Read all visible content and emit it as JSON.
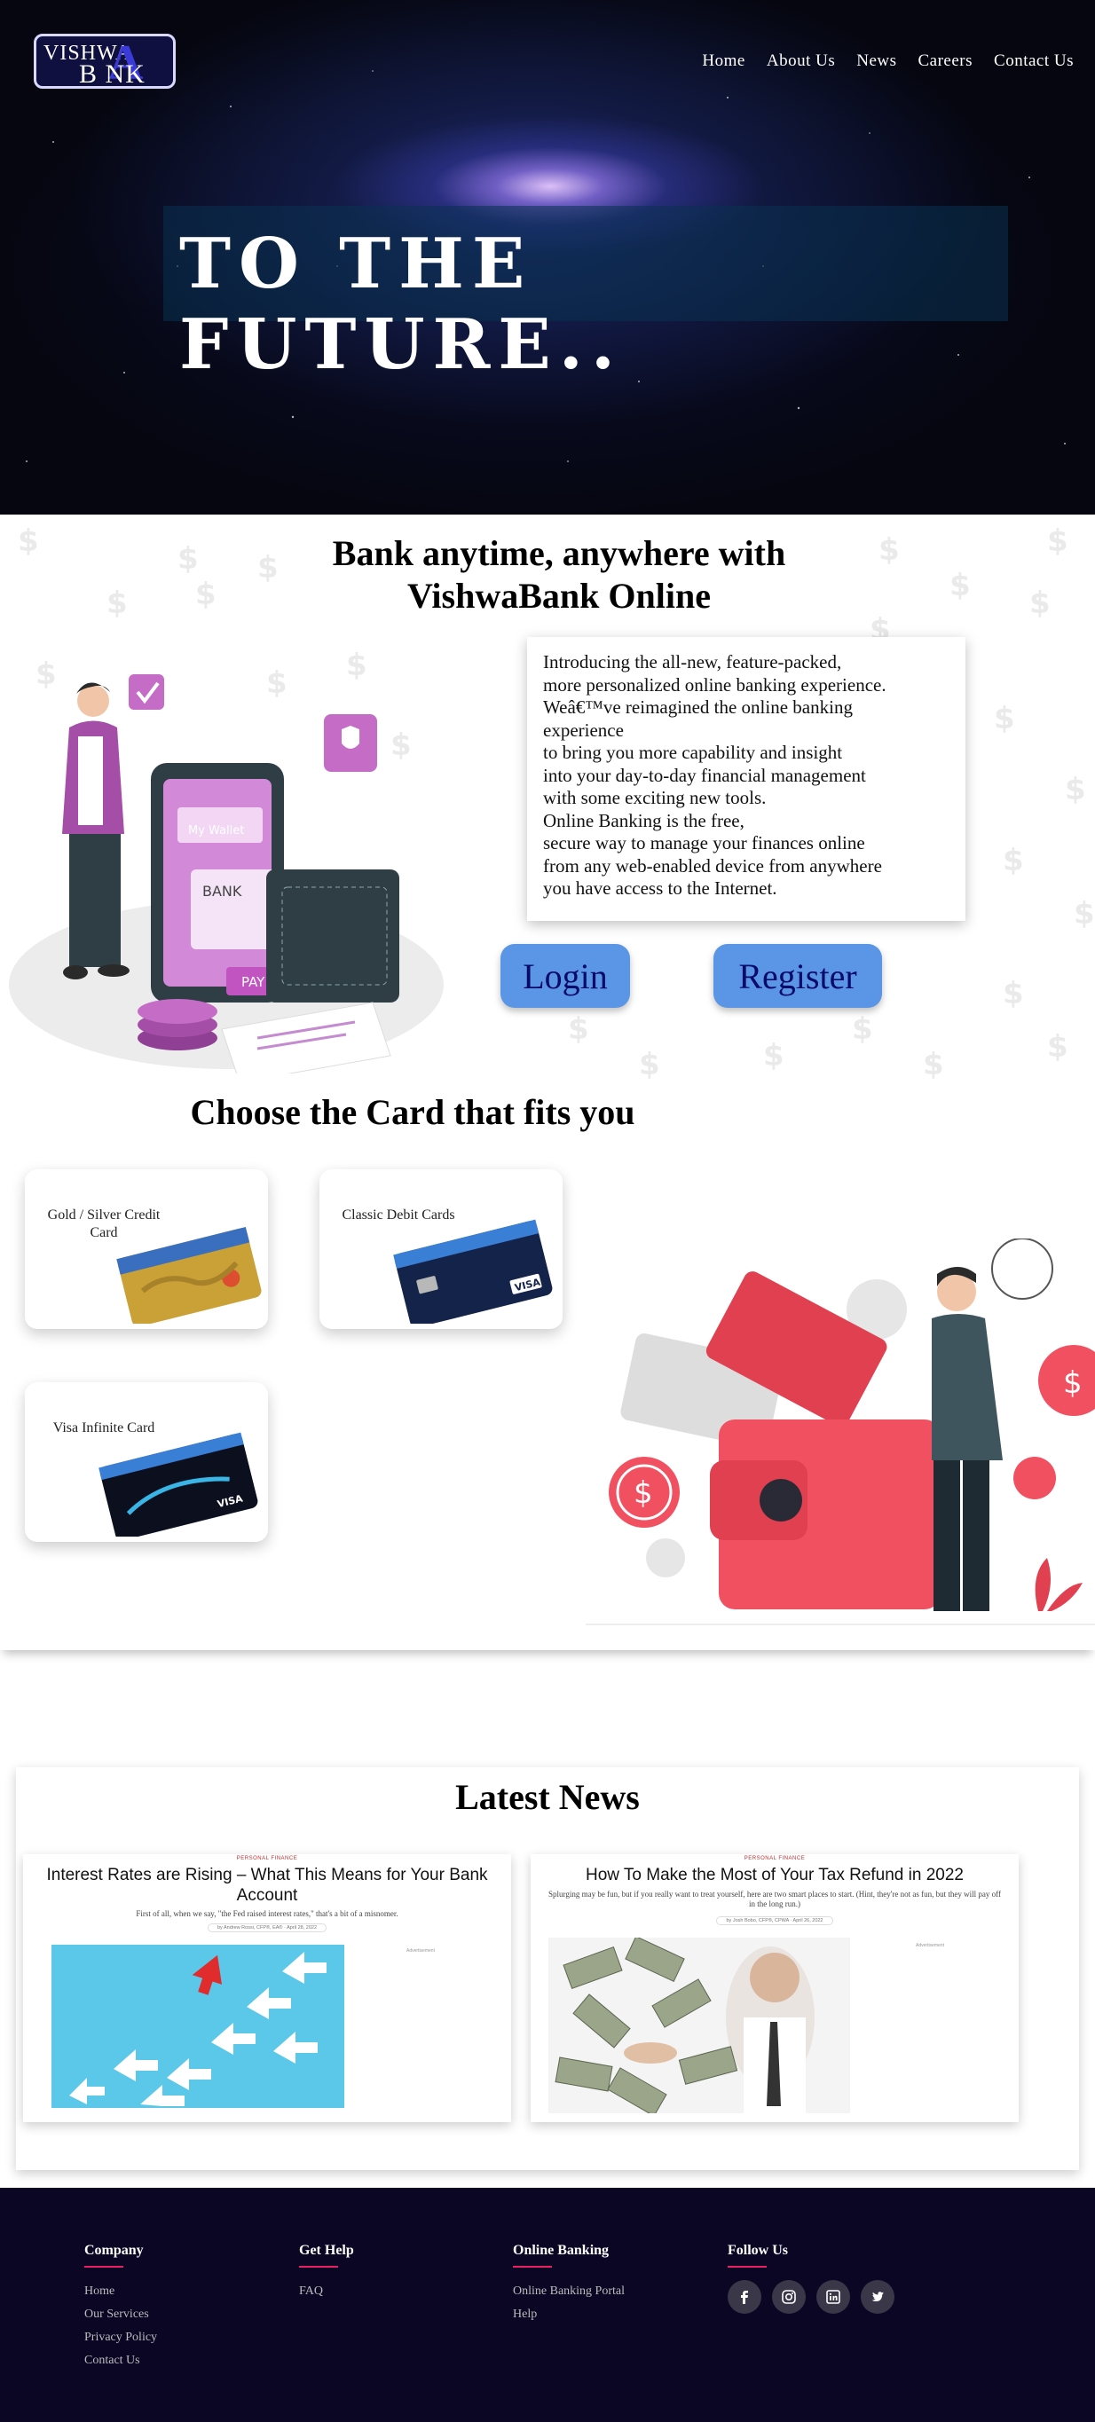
{
  "header": {
    "logo_top": "VISHWA",
    "logo_bottom": "B  NK",
    "logo_a": "A",
    "nav": [
      "Home",
      "About Us",
      "News",
      "Careers",
      "Contact Us"
    ],
    "hero_title": "TO THE FUTURE.."
  },
  "online": {
    "title_line1": "Bank anytime, anywhere with",
    "title_line2": "VishwaBank Online",
    "intro_lines": [
      "Introducing the all-new, feature-packed,",
      "more personalized online banking experience.",
      "Weâ€™ve reimagined the online banking",
      "experience",
      "to bring you more capability and insight",
      "into your day-to-day financial management",
      "with some exciting new tools.",
      "Online Banking is the free,",
      "secure way to manage your finances online",
      "from any web-enabled device from anywhere",
      "you have access to the Internet."
    ],
    "login_label": "Login",
    "register_label": "Register"
  },
  "cards": {
    "title": "Choose the Card that fits you",
    "items": [
      {
        "label": "Gold / Silver Credit Card"
      },
      {
        "label": "Classic Debit Cards"
      },
      {
        "label": "Visa Infinite Card"
      }
    ]
  },
  "news": {
    "title": "Latest News",
    "items": [
      {
        "category": "PERSONAL FINANCE",
        "headline": "Interest Rates are Rising – What This Means for Your Bank Account",
        "excerpt": "First of all, when we say, \"the Fed raised interest rates,\" that's a bit of a misnomer.",
        "meta": "by Andrew Rossi, CFP®, EA® · April 28, 2022",
        "ad_label": "Advertisement"
      },
      {
        "category": "PERSONAL FINANCE",
        "headline": "How To Make the Most of Your Tax Refund in 2022",
        "excerpt": "Splurging may be fun, but if you really want to treat yourself, here are two smart places to start. (Hint, they're not as fun, but they will pay off in the long run.)",
        "meta": "by Josh Bobo, CFP®, CPWA · April 26, 2022",
        "ad_label": "Advertisement"
      }
    ]
  },
  "footer": {
    "columns": [
      {
        "heading": "Company",
        "links": [
          "Home",
          "Our Services",
          "Privacy Policy",
          "Contact Us"
        ]
      },
      {
        "heading": "Get Help",
        "links": [
          "FAQ"
        ]
      },
      {
        "heading": "Online Banking",
        "links": [
          "Online Banking Portal",
          "Help"
        ]
      },
      {
        "heading": "Follow Us",
        "links": []
      }
    ],
    "social_icons": [
      "facebook-icon",
      "instagram-icon",
      "linkedin-icon",
      "twitter-icon"
    ]
  },
  "colors": {
    "button": "#5b96e6",
    "footer_bg": "#0c0625",
    "footer_accent": "#e91e63"
  }
}
